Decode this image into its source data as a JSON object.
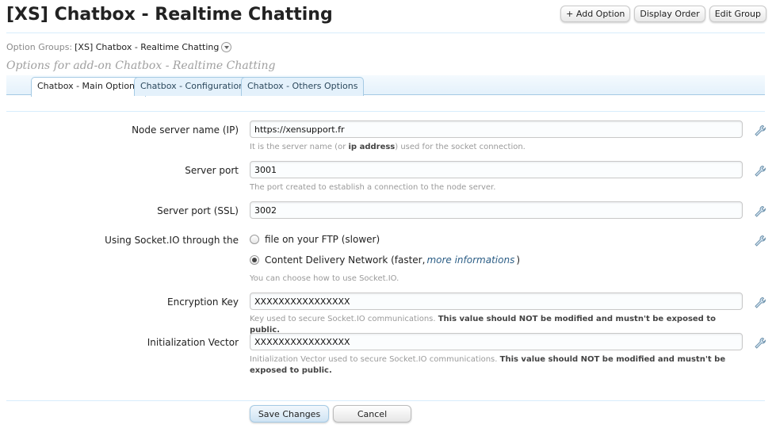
{
  "header": {
    "title": "[XS] Chatbox - Realtime Chatting",
    "buttons": {
      "add_option": "+ Add Option",
      "display_order": "Display Order",
      "edit_group": "Edit Group"
    }
  },
  "breadcrumb": {
    "label": "Option Groups:",
    "value": "[XS] Chatbox - Realtime Chatting"
  },
  "subtitle": "Options for add-on Chatbox - Realtime Chatting",
  "tabs": [
    {
      "label": "Chatbox - Main Options",
      "active": true
    },
    {
      "label": "Chatbox - Configuration",
      "active": false
    },
    {
      "label": "Chatbox - Others Options",
      "active": false
    }
  ],
  "options": {
    "node_server": {
      "label": "Node server name (IP)",
      "value": "https://xensupport.fr",
      "explain_pre": "It is the server name (or ",
      "explain_bold": "ip address",
      "explain_post": ") used for the socket connection."
    },
    "server_port": {
      "label": "Server port",
      "value": "3001",
      "explain": "The port created to establish a connection to the node server."
    },
    "server_port_ssl": {
      "label": "Server port (SSL)",
      "value": "3002"
    },
    "socketio_source": {
      "label": "Using Socket.IO through the",
      "choice_ftp": "file on your FTP (slower)",
      "choice_cdn_pre": "Content Delivery Network (faster, ",
      "choice_cdn_link": "more informations",
      "choice_cdn_post": ")",
      "selected": "cdn",
      "explain": "You can choose how to use Socket.IO."
    },
    "encryption_key": {
      "label": "Encryption Key",
      "value": "XXXXXXXXXXXXXXXX",
      "explain_pre": "Key used to secure Socket.IO communications. ",
      "explain_bold": "This value should NOT be modified and mustn't be exposed to public."
    },
    "init_vector": {
      "label": "Initialization Vector",
      "value": "XXXXXXXXXXXXXXXX",
      "explain_pre": "Initialization Vector used to secure Socket.IO communications. ",
      "explain_bold": "This value should NOT be modified and mustn't be exposed to public."
    }
  },
  "actions": {
    "save": "Save Changes",
    "cancel": "Cancel"
  },
  "icons": {
    "wrench": "wrench-icon",
    "dropdown": "chevron-down-icon"
  },
  "colors": {
    "tab_border": "#a5cae4",
    "link": "#2b5d85"
  }
}
